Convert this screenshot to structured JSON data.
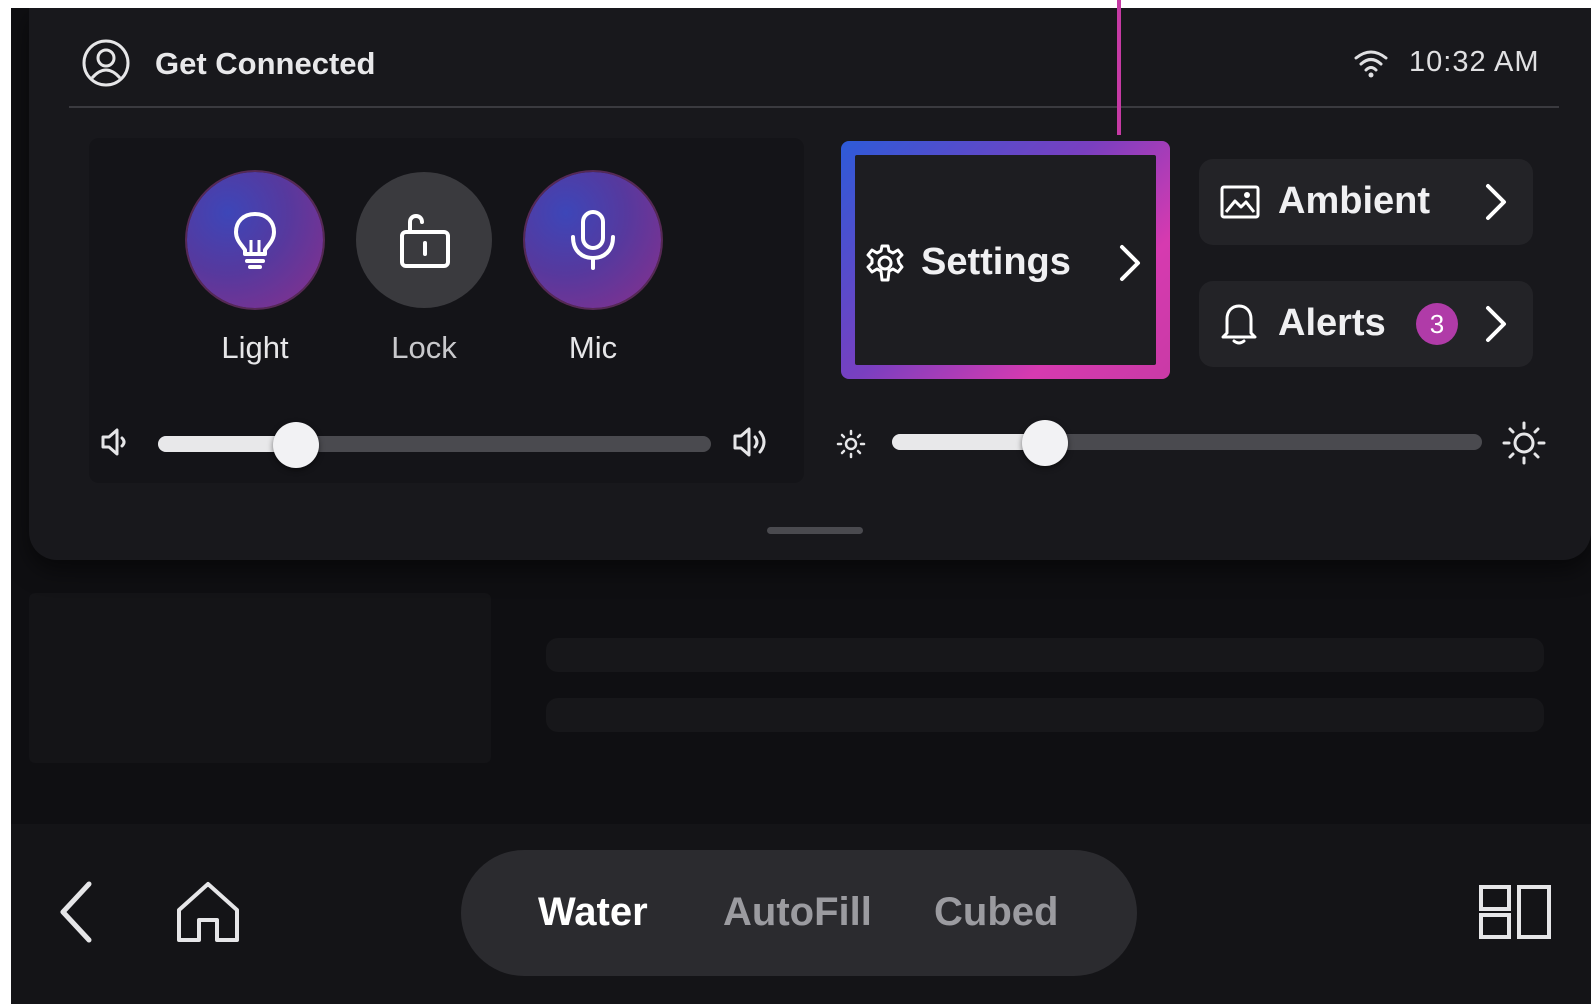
{
  "status_bar": {
    "title": "Get Connected",
    "time": "10:32 AM"
  },
  "quick_buttons": [
    {
      "label": "Light",
      "state": "on"
    },
    {
      "label": "Lock",
      "state": "off"
    },
    {
      "label": "Mic",
      "state": "on"
    }
  ],
  "volume": {
    "level_percent": 25
  },
  "brightness": {
    "level_percent": 26
  },
  "tiles": {
    "settings_label": "Settings",
    "ambient_label": "Ambient",
    "alerts_label": "Alerts",
    "alerts_count": "3"
  },
  "nav": {
    "tabs": [
      {
        "label": "Water",
        "active": true
      },
      {
        "label": "AutoFill",
        "active": false
      },
      {
        "label": "Cubed",
        "active": false
      }
    ]
  },
  "colors": {
    "accent_magenta": "#c63aa4",
    "accent_blue": "#2d5bd8",
    "background": "#0f0f12"
  },
  "icons": [
    "profile-icon",
    "wifi-icon",
    "lightbulb-icon",
    "unlock-icon",
    "microphone-icon",
    "volume-low-icon",
    "volume-high-icon",
    "brightness-low-icon",
    "brightness-high-icon",
    "gear-icon",
    "image-icon",
    "bell-icon",
    "chevron-right-icon",
    "back-icon",
    "home-icon",
    "layout-icon"
  ]
}
